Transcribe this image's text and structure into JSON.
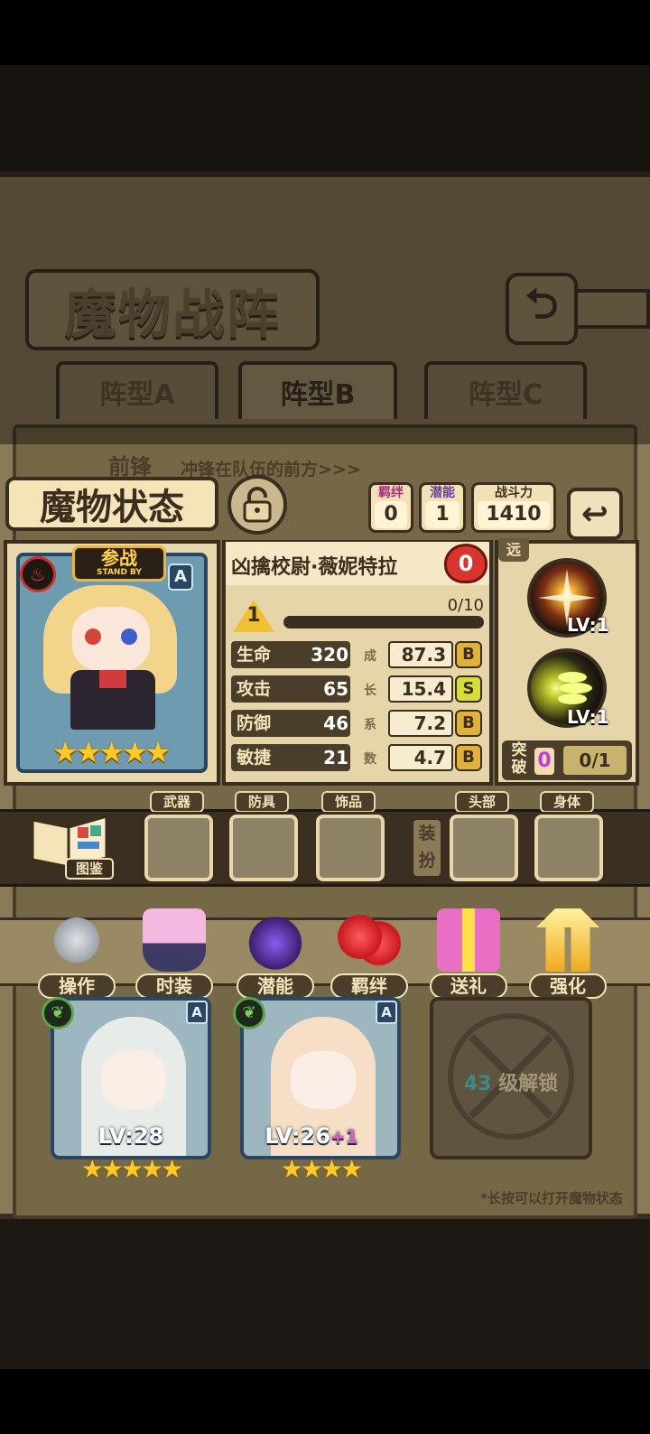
{
  "header": {
    "title": "魔物战阵"
  },
  "formation_tabs": [
    {
      "label": "阵型A",
      "active": false
    },
    {
      "label": "阵型B",
      "active": true
    },
    {
      "label": "阵型C",
      "active": false
    }
  ],
  "row_label": {
    "title": "前锋",
    "desc": "冲锋在队伍的前方>>>"
  },
  "status": {
    "title": "魔物状态",
    "bond": {
      "label": "羁绊",
      "value": "0"
    },
    "potential": {
      "label": "潜能",
      "value": "1"
    },
    "power": {
      "label": "战斗力",
      "value": "1410"
    }
  },
  "character": {
    "badge_main": "参战",
    "badge_sub": "STAND BY",
    "rank": "A",
    "stars": "★★★★★",
    "name": "凶擒校尉·薇妮特拉",
    "heart_value": "0",
    "level": "1",
    "xp_text": "0/10",
    "xp_fraction": 0.0,
    "stats": [
      {
        "label": "生命",
        "value": "320",
        "growth": "87.3",
        "grade": "B",
        "grade_color": "#e0b23b"
      },
      {
        "label": "攻击",
        "value": "65",
        "growth": "15.4",
        "grade": "S",
        "grade_color": "#d6dc3a"
      },
      {
        "label": "防御",
        "value": "46",
        "growth": "7.2",
        "grade": "B",
        "grade_color": "#e0b23b"
      },
      {
        "label": "敏捷",
        "value": "21",
        "growth": "4.7",
        "grade": "B",
        "grade_color": "#e0b23b"
      }
    ],
    "growth_label": [
      "成",
      "长",
      "系",
      "数"
    ]
  },
  "skills": {
    "range_label": "远",
    "items": [
      {
        "level": "LV:1",
        "icon": "burst-icon"
      },
      {
        "level": "LV:1",
        "icon": "spread-shot-icon"
      }
    ],
    "breakthrough": {
      "label": "突破",
      "value": "0",
      "progress": "0/1"
    }
  },
  "equipment": {
    "codex_label": "图鉴",
    "slots": [
      "武器",
      "防具",
      "饰品"
    ],
    "dress_label": "装扮",
    "dress_slots": [
      "头部",
      "身体"
    ]
  },
  "actions": [
    {
      "label": "操作",
      "icon": "gear-icon"
    },
    {
      "label": "时装",
      "icon": "outfit-icon"
    },
    {
      "label": "潜能",
      "icon": "demon-icon"
    },
    {
      "label": "羁绊",
      "icon": "hearts-icon"
    },
    {
      "label": "送礼",
      "icon": "gift-icon"
    },
    {
      "label": "强化",
      "icon": "upgrade-arrows-icon"
    }
  ],
  "roster": [
    {
      "level": "LV:28",
      "stars": "★★★★★",
      "rank": "A"
    },
    {
      "level": "LV:26",
      "plus": "+1",
      "stars": "★★★★",
      "rank": "A"
    }
  ],
  "locked_slot": {
    "level": "43",
    "text": "级解锁"
  },
  "hint": "*长按可以打开魔物状态"
}
